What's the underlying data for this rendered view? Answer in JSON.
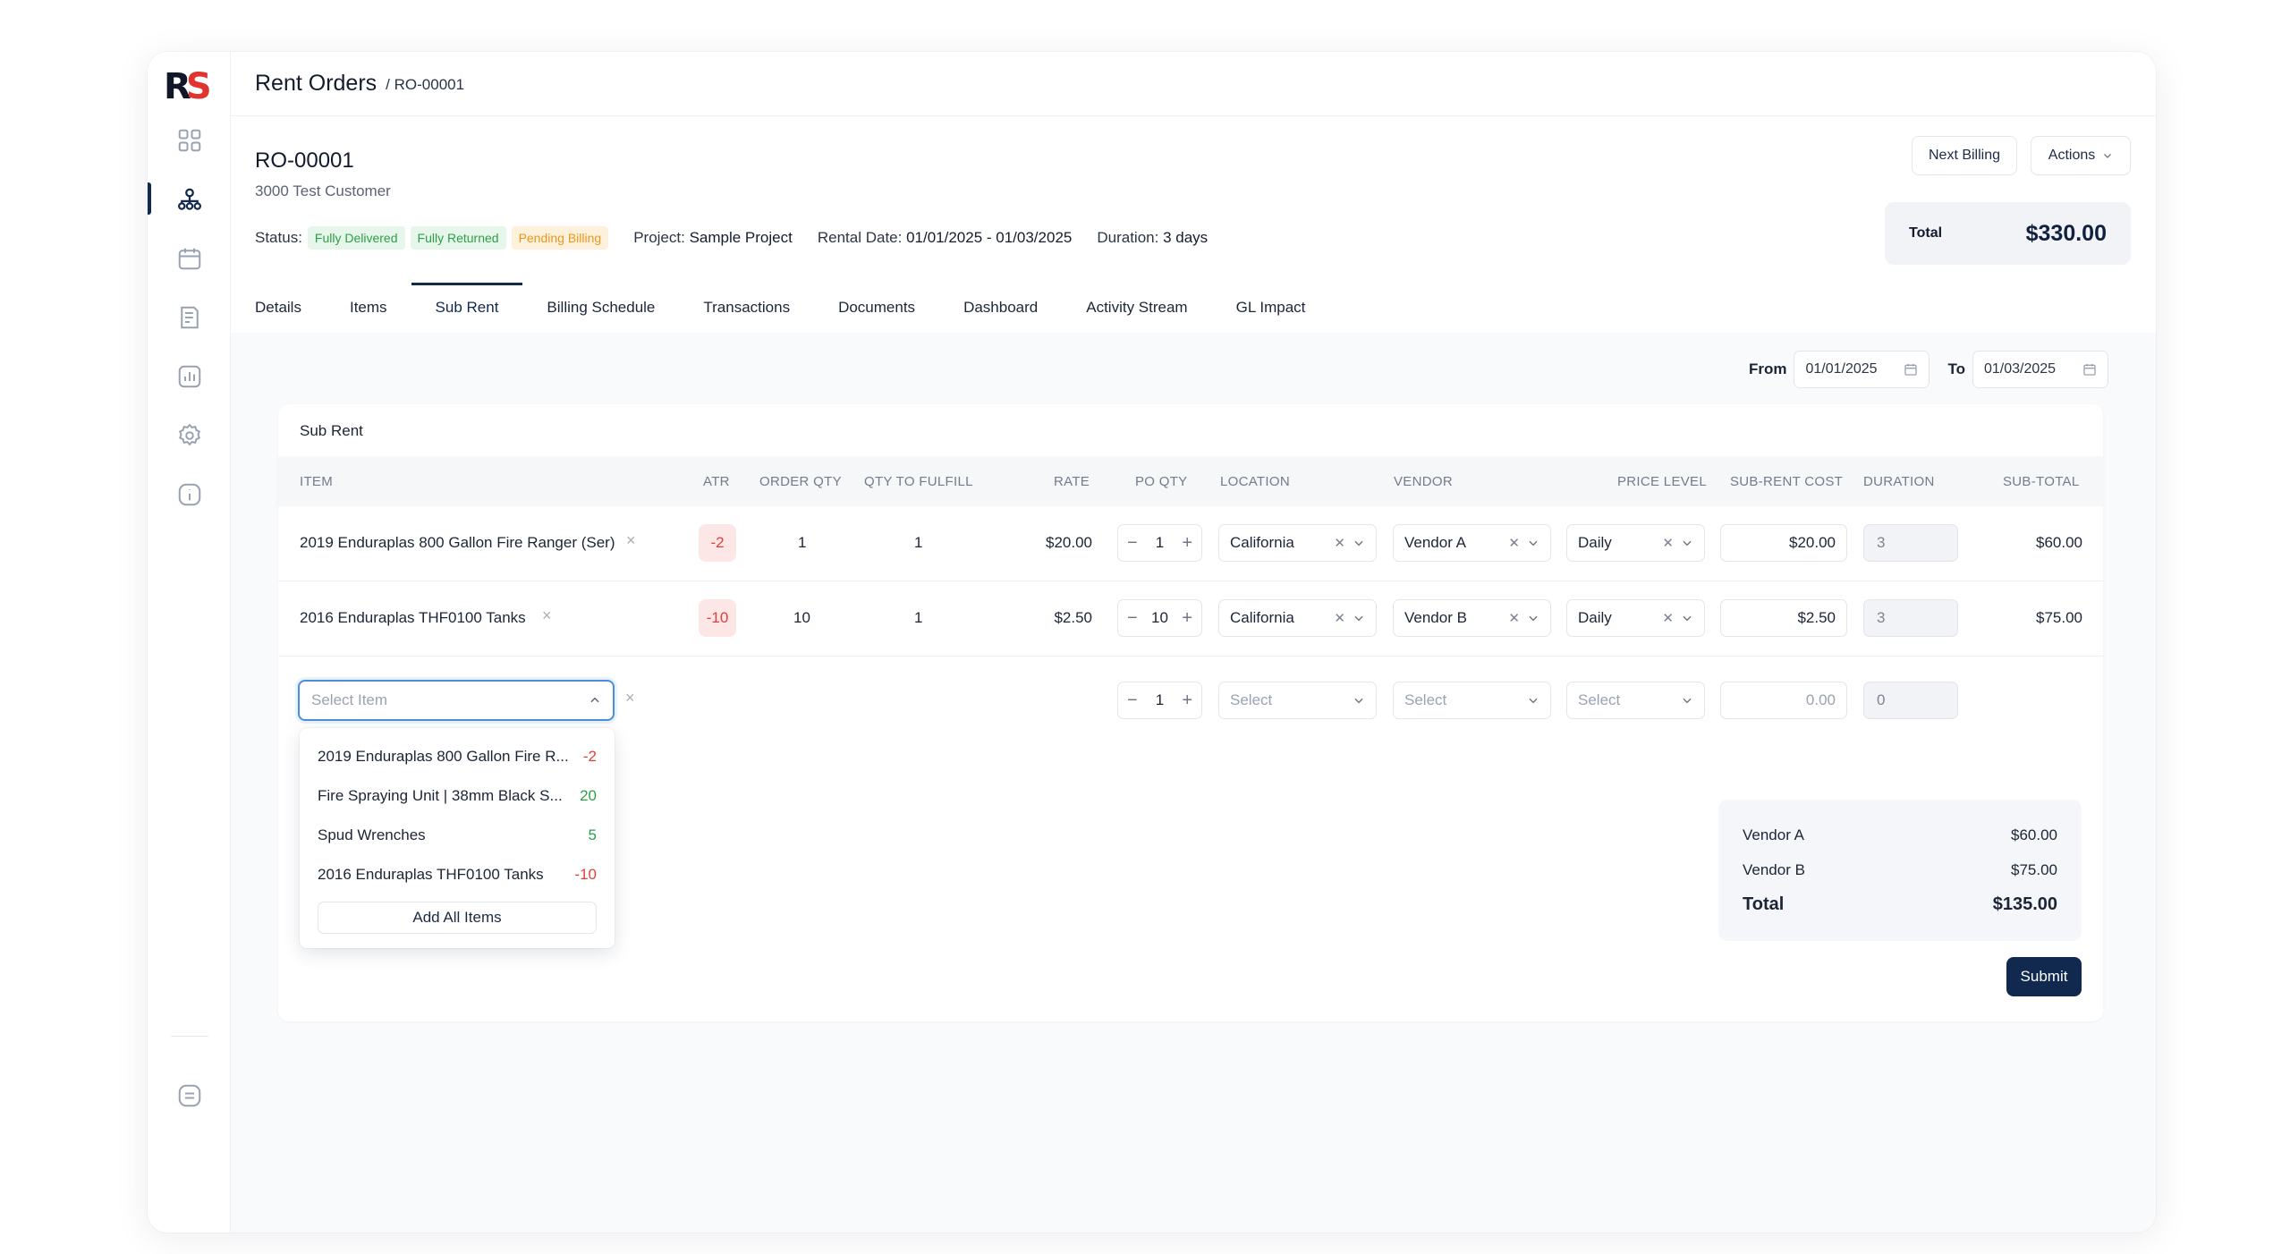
{
  "header": {
    "title": "Rent Orders",
    "breadcrumb": "/ RO-00001"
  },
  "order": {
    "id": "RO-00001",
    "customer": "3000 Test Customer",
    "status_label": "Status:",
    "badges": [
      "Fully Delivered",
      "Fully Returned",
      "Pending Billing"
    ],
    "project_label": "Project:",
    "project": "Sample Project",
    "rental_label": "Rental Date:",
    "rental_date": "01/01/2025 - 01/03/2025",
    "duration_label": "Duration:",
    "duration": "3 days",
    "next_billing": "Next Billing",
    "actions": "Actions",
    "total_label": "Total",
    "total_value": "$330.00"
  },
  "tabs": [
    "Details",
    "Items",
    "Sub Rent",
    "Billing Schedule",
    "Transactions",
    "Documents",
    "Dashboard",
    "Activity Stream",
    "GL Impact"
  ],
  "active_tab": "Sub Rent",
  "filter": {
    "from_label": "From",
    "from": "01/01/2025",
    "to_label": "To",
    "to": "01/03/2025"
  },
  "subrent": {
    "title": "Sub Rent",
    "columns": [
      "ITEM",
      "ATR",
      "ORDER QTY",
      "QTY TO FULFILL",
      "RATE",
      "PO QTY",
      "LOCATION",
      "VENDOR",
      "PRICE LEVEL",
      "SUB-RENT COST",
      "DURATION",
      "SUB-TOTAL"
    ],
    "rows": [
      {
        "item": "2019 Enduraplas 800 Gallon Fire Ranger (Ser)",
        "atr": "-2",
        "order_qty": "1",
        "qty_to_fulfill": "1",
        "rate": "$20.00",
        "po_qty": "1",
        "location": "California",
        "vendor": "Vendor A",
        "price_level": "Daily",
        "cost": "$20.00",
        "duration": "3",
        "subtotal": "$60.00"
      },
      {
        "item": "2016 Enduraplas THF0100 Tanks",
        "atr": "-10",
        "order_qty": "10",
        "qty_to_fulfill": "1",
        "rate": "$2.50",
        "po_qty": "10",
        "location": "California",
        "vendor": "Vendor B",
        "price_level": "Daily",
        "cost": "$2.50",
        "duration": "3",
        "subtotal": "$75.00"
      }
    ],
    "new_row": {
      "item_placeholder": "Select Item",
      "po_qty": "1",
      "location": "Select",
      "vendor": "Select",
      "price_level": "Select",
      "cost": "0.00",
      "duration": "0"
    },
    "dropdown": {
      "items": [
        {
          "name": "2019 Enduraplas 800 Gallon Fire R...",
          "count": "-2"
        },
        {
          "name": "Fire Spraying Unit | 38mm Black S...",
          "count": "20"
        },
        {
          "name": "Spud Wrenches",
          "count": "5"
        },
        {
          "name": "2016 Enduraplas THF0100 Tanks",
          "count": "-10"
        }
      ],
      "add_all": "Add All Items"
    },
    "summary": [
      {
        "label": "Vendor A",
        "value": "$60.00"
      },
      {
        "label": "Vendor B",
        "value": "$75.00"
      }
    ],
    "summary_total_label": "Total",
    "summary_total": "$135.00",
    "submit": "Submit"
  },
  "colors": {
    "primary": "#11294f",
    "danger": "#e0403c",
    "success": "#2e9e47",
    "warning": "#e8961f",
    "focus": "#4b8fd8"
  }
}
